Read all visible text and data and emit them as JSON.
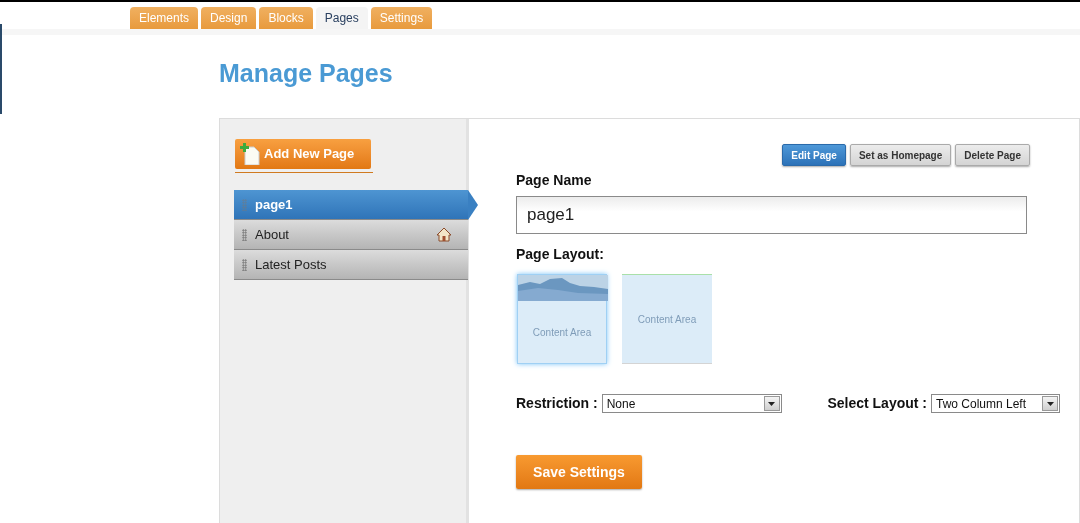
{
  "tabs": [
    {
      "label": "Elements",
      "selected": false
    },
    {
      "label": "Design",
      "selected": false
    },
    {
      "label": "Blocks",
      "selected": false
    },
    {
      "label": "Pages",
      "selected": true
    },
    {
      "label": "Settings",
      "selected": false
    }
  ],
  "title": "Manage Pages",
  "add_button": "Add New Page",
  "pages": [
    {
      "label": "page1",
      "selected": true,
      "homepage": false
    },
    {
      "label": "About",
      "selected": false,
      "homepage": true
    },
    {
      "label": "Latest Posts",
      "selected": false,
      "homepage": false
    }
  ],
  "actions": [
    {
      "label": "Edit Page",
      "selected": true
    },
    {
      "label": "Set as Homepage",
      "selected": false
    },
    {
      "label": "Delete Page",
      "selected": false
    }
  ],
  "page_name": {
    "label": "Page Name",
    "value": "page1"
  },
  "layout": {
    "label": "Page Layout:",
    "options": [
      {
        "kind": "header",
        "text": "Content Area",
        "selected": true
      },
      {
        "kind": "plain",
        "text": "Content Area",
        "selected": false
      }
    ]
  },
  "restriction": {
    "label": "Restriction :",
    "value": "None"
  },
  "select_layout": {
    "label": "Select Layout :",
    "value": "Two Column Left"
  },
  "save_button": "Save Settings"
}
